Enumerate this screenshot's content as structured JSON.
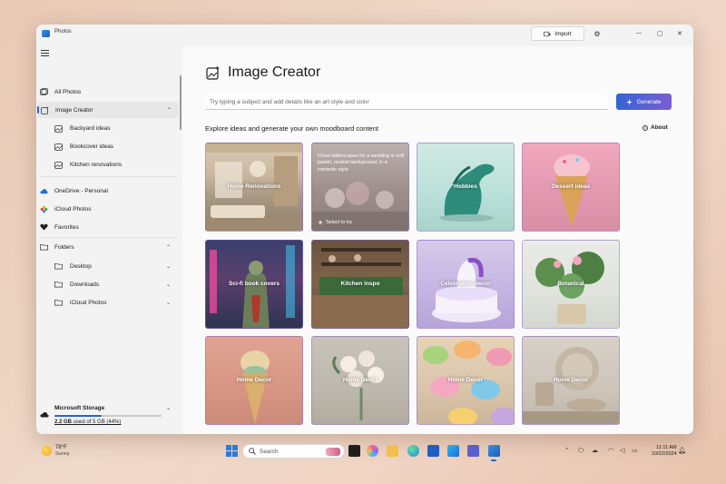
{
  "window": {
    "app_title": "Photos",
    "import_label": "Import",
    "minimize_glyph": "—",
    "maximize_glyph": "▢",
    "close_glyph": "✕",
    "settings_glyph": "⚙"
  },
  "sidebar": {
    "items": [
      {
        "label": "All Photos",
        "icon": "photos-icon"
      },
      {
        "label": "Image Creator",
        "icon": "image-creator-icon"
      },
      {
        "label": "Backyard ideas",
        "icon": "collection-icon"
      },
      {
        "label": "Bookcover ideas",
        "icon": "collection-icon"
      },
      {
        "label": "Kitchen renovations",
        "icon": "collection-icon"
      },
      {
        "label": "OneDrive - Personal",
        "icon": "onedrive-icon"
      },
      {
        "label": "iCloud Photos",
        "icon": "icloud-icon"
      },
      {
        "label": "Favorites",
        "icon": "heart-icon"
      },
      {
        "label": "Folders",
        "icon": "folder-icon"
      },
      {
        "label": "Desktop",
        "icon": "folder-icon"
      },
      {
        "label": "Downloads",
        "icon": "folder-icon"
      },
      {
        "label": "iCloud Photos",
        "icon": "folder-icon"
      }
    ],
    "chevron_up": "⌃",
    "chevron_down": "⌄",
    "storage": {
      "title": "Microsoft Storage",
      "used": "2.2 GB",
      "usage_rest": " used of 5 GB (44%)",
      "used_fraction": 0.44,
      "accent": "#2a65c4"
    }
  },
  "main": {
    "title": "Image Creator",
    "prompt_placeholder": "Try typing a subject and add details like an art style and color",
    "generate_label": "Generate",
    "explore_heading": "Explore ideas and generate your own moodboard content",
    "about_label": "About",
    "cards": [
      {
        "label": "Home Renovations"
      },
      {
        "label": "",
        "overlay": "Floral tablescapes for a wedding in soft pastel, neutral background, in a romantic style",
        "select": "Select to try"
      },
      {
        "label": "Hobbies"
      },
      {
        "label": "Dessert ideas"
      },
      {
        "label": "Sci-fi book covers"
      },
      {
        "label": "Kitchen inspo"
      },
      {
        "label": "Celebration decor"
      },
      {
        "label": "Botanical"
      },
      {
        "label": "Home Decor"
      },
      {
        "label": "Home Decor"
      },
      {
        "label": "Home Decor"
      },
      {
        "label": "Home Decor"
      }
    ]
  },
  "taskbar": {
    "temperature": "78°F",
    "condition": "Sunny",
    "search_label": "Search",
    "time": "11:11 AM",
    "date": "10/22/2024"
  }
}
